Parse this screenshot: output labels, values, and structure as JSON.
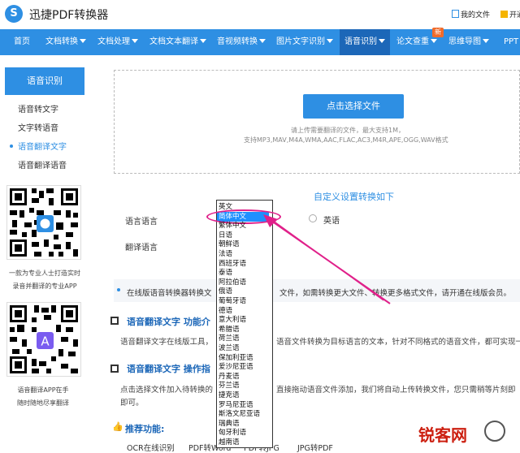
{
  "header": {
    "logo_text": "迅捷PDF转换器",
    "my_files": "我的文件",
    "open_vip": "开通"
  },
  "nav": {
    "items": [
      {
        "label": "首页"
      },
      {
        "label": "文档转换"
      },
      {
        "label": "文档处理"
      },
      {
        "label": "文档文本翻译"
      },
      {
        "label": "音视频转换"
      },
      {
        "label": "图片文字识别"
      },
      {
        "label": "语音识别"
      },
      {
        "label": "论文查重"
      },
      {
        "label": "思维导图"
      },
      {
        "label": "PPT"
      }
    ],
    "new_badge": "新"
  },
  "sidebar": {
    "title": "语音识别",
    "items": [
      {
        "label": "语音转文字"
      },
      {
        "label": "文字转语音"
      },
      {
        "label": "语音翻译文字"
      },
      {
        "label": "语音翻译语音"
      }
    ],
    "qr1_caption_line1": "一款为专业人士打造实时",
    "qr1_caption_line2": "录音并翻译的专业APP",
    "qr2_caption_line1": "语音翻译APP在手",
    "qr2_caption_line2": "随时随地尽享翻译"
  },
  "upload": {
    "button_label": "点击选择文件",
    "hint_line1": "请上传需要翻译的文件，最大支持1M，",
    "hint_line2": "支持MP3,MAV,M4A,WMA,AAC,FLAC,AC3,M4R,APE,OGG,WAV格式"
  },
  "settings": {
    "title": "自定义设置转换如下",
    "language_label": "语言语言",
    "translate_label": "翻译语言",
    "english_option": "英语"
  },
  "notice": {
    "text_a": "在线版语音转换器转换文",
    "text_b": "文件，如需转换更大文件、转换更多格式文件，请开通在线版会员。"
  },
  "sections": {
    "intro_title": "语音翻译文字 功能介",
    "intro_text_a": "语音翻译文字在线版工具，",
    "intro_text_b": "语音文件转换为目标语言的文本，针对不同格式的语音文件，都可实现一",
    "guide_title": "语音翻译文字 操作指",
    "guide_text_a": "点击选择文件加入待转换的",
    "guide_text_b": "直接拖动语音文件添加，我们将自动上传转换文件，您只需稍等片刻即",
    "guide_text_c": "即可。"
  },
  "recommend": {
    "title": "推荐功能:",
    "links": [
      "OCR在线识别",
      "PDF转Word",
      "PDF转JPG",
      "JPG转PDF"
    ]
  },
  "dropdown": {
    "items": [
      "英文",
      "简体中文",
      "繁体中文",
      "日语",
      "朝鲜语",
      "法语",
      "西班牙语",
      "泰语",
      "阿拉伯语",
      "俄语",
      "葡萄牙语",
      "德语",
      "意大利语",
      "希腊语",
      "荷兰语",
      "波兰语",
      "保加利亚语",
      "爱沙尼亚语",
      "丹麦语",
      "芬兰语",
      "捷克语",
      "罗马尼亚语",
      "斯洛文尼亚语",
      "瑞典语",
      "匈牙利语",
      "越南语"
    ],
    "selected_index": 1
  },
  "watermark": {
    "text": "锐客网"
  },
  "colors": {
    "primary": "#2e8fe3",
    "nav_active": "#1c67b8",
    "annotation": "#e0218a",
    "watermark": "#cc1f10"
  }
}
